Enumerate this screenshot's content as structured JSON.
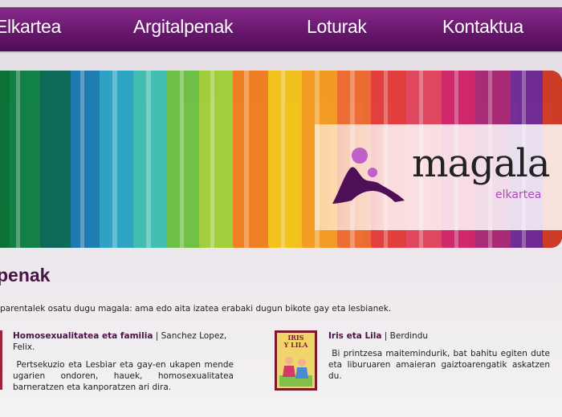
{
  "nav": {
    "items": [
      {
        "label": "Elkartea"
      },
      {
        "label": "Argitalpenak"
      },
      {
        "label": "Loturak"
      },
      {
        "label": "Kontaktua"
      }
    ]
  },
  "banner": {
    "logo_word": "magala",
    "logo_sub": "elkartea"
  },
  "page": {
    "title": "penak",
    "intro": "parentalek osatu dugu magala: ama edo aita izatea erabaki dugun bikote gay eta lesbianek."
  },
  "books": [
    {
      "title": "Homosexualitatea eta familia",
      "sep": " | ",
      "author": "Sanchez Lopez, Felix.",
      "description": "Pertsekuzio eta Lesbiar eta gay-en ukapen mende ugarien ondoren, hauek, homosexualitatea barneratzen eta kanporatzen ari dira."
    },
    {
      "title": "Iris eta Lila",
      "sep": " | ",
      "author": "Berdindu",
      "description": "Bi printzesa maitemindurik, bat bahitu egiten dute eta liburuaren amaieran gaiztoarengatik askatzen du.",
      "cover_text": [
        "IRIS",
        "Y LILA"
      ]
    }
  ],
  "colors": {
    "nav": "#6d1a72",
    "title": "#4a1444",
    "logo_accent": "#b447b9"
  }
}
